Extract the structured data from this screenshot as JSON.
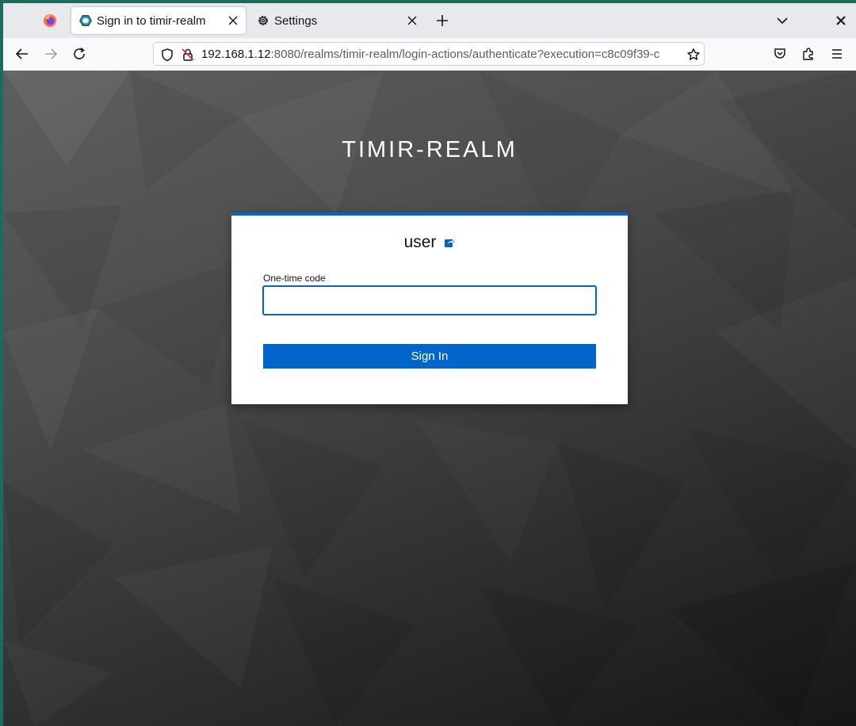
{
  "browser": {
    "tabs": [
      {
        "title": "Sign in to timir-realm",
        "active": true
      },
      {
        "title": "Settings",
        "active": false
      }
    ],
    "url": {
      "host": "192.168.1.12",
      "rest": ":8080/realms/timir-realm/login-actions/authenticate?execution=c8c09f39-c"
    }
  },
  "page": {
    "realm_title": "TIMIR-REALM",
    "username": "user",
    "otp_label": "One-time code",
    "otp_value": "",
    "signin_label": "Sign In"
  },
  "colors": {
    "accent": "#0066cc",
    "background_light": "#5f5f5f",
    "background_dark": "#161616"
  }
}
